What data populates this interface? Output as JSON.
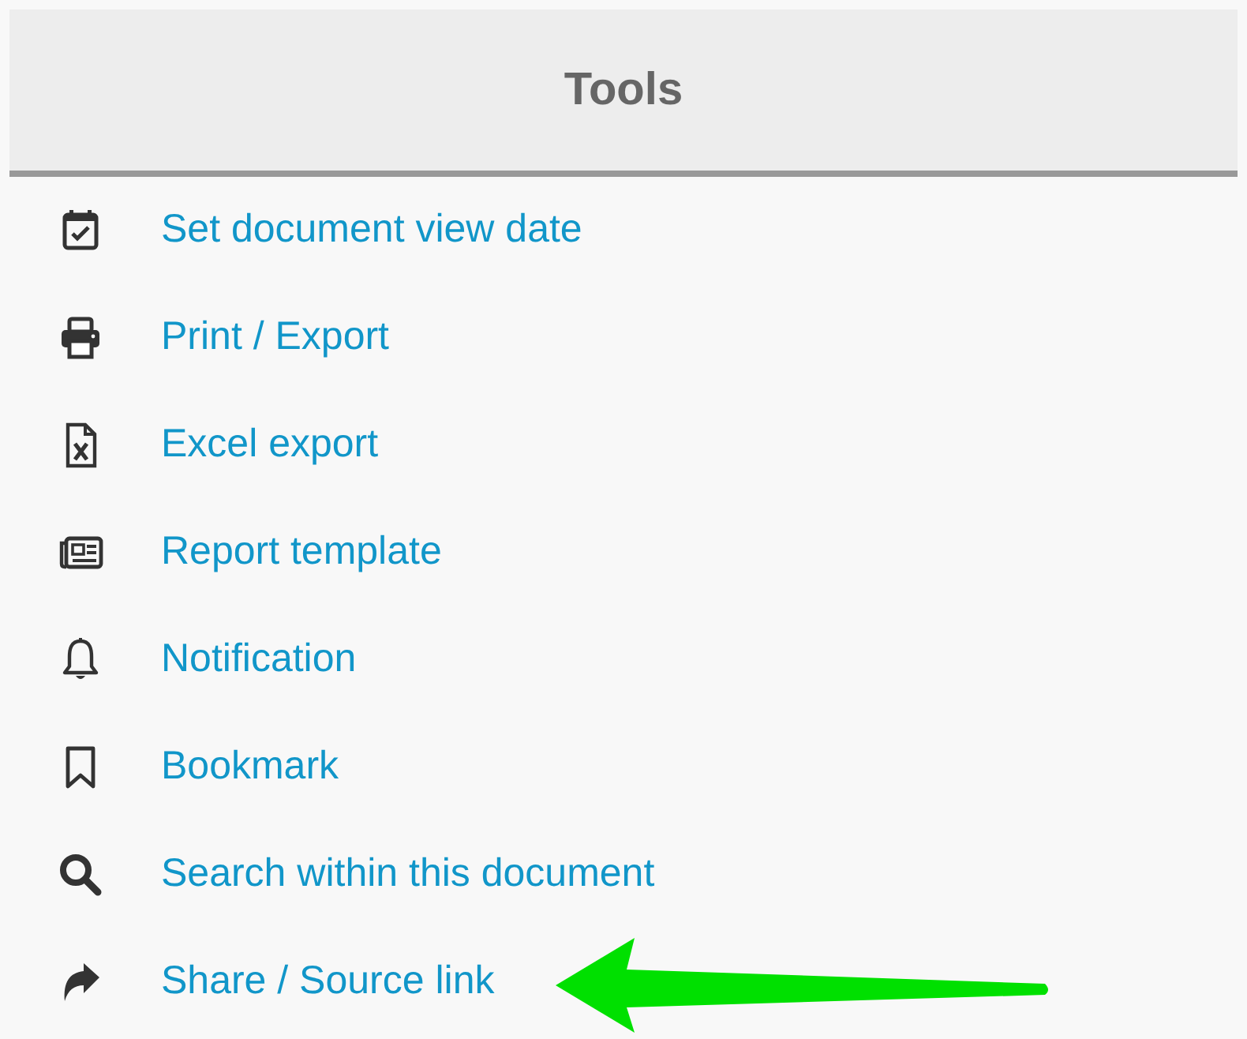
{
  "panel": {
    "title": "Tools"
  },
  "items": [
    {
      "label": "Set document view date",
      "kind": "calendar"
    },
    {
      "label": "Print / Export",
      "kind": "printer"
    },
    {
      "label": "Excel export",
      "kind": "excel"
    },
    {
      "label": "Report template",
      "kind": "newspaper"
    },
    {
      "label": "Notification",
      "kind": "bell"
    },
    {
      "label": "Bookmark",
      "kind": "bookmark"
    },
    {
      "label": "Search within this document",
      "kind": "search"
    },
    {
      "label": "Share / Source link",
      "kind": "share"
    }
  ]
}
